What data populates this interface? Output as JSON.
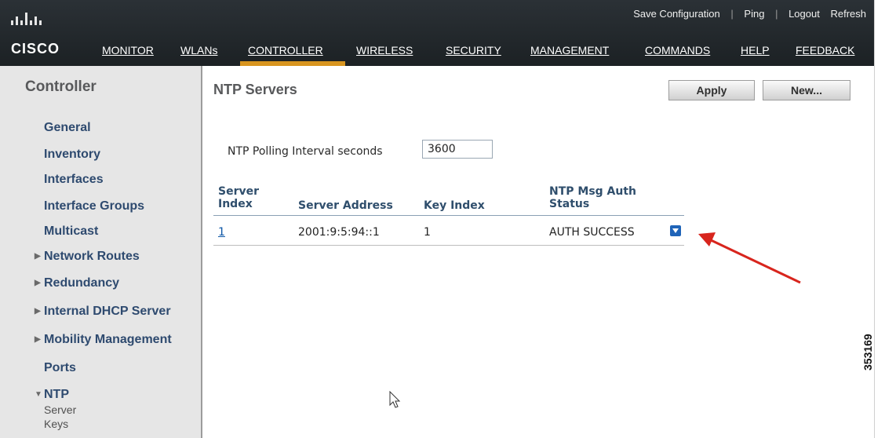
{
  "header": {
    "logo_text": "CISCO",
    "top_links": {
      "save_configuration": "Save Configuration",
      "ping": "Ping",
      "logout": "Logout",
      "refresh": "Refresh",
      "separator": "|"
    },
    "nav": [
      "MONITOR",
      "WLANs",
      "CONTROLLER",
      "WIRELESS",
      "SECURITY",
      "MANAGEMENT",
      "COMMANDS",
      "HELP",
      "FEEDBACK"
    ],
    "active_tab": "CONTROLLER",
    "active_color": "#d8951f"
  },
  "sidebar": {
    "title": "Controller",
    "items": [
      {
        "label": "General",
        "expandable": false
      },
      {
        "label": "Inventory",
        "expandable": false
      },
      {
        "label": "Interfaces",
        "expandable": false
      },
      {
        "label": "Interface Groups",
        "expandable": false
      },
      {
        "label": "Multicast",
        "expandable": false
      },
      {
        "label": "Network Routes",
        "expandable": true
      },
      {
        "label": "Redundancy",
        "expandable": true
      },
      {
        "label": "Internal DHCP Server",
        "expandable": true
      },
      {
        "label": "Mobility Management",
        "expandable": true
      },
      {
        "label": "Ports",
        "expandable": false
      },
      {
        "label": "NTP",
        "expandable": true,
        "expanded": true,
        "children": [
          "Server",
          "Keys"
        ]
      }
    ]
  },
  "main": {
    "page_title": "NTP Servers",
    "buttons": {
      "apply": "Apply",
      "new": "New..."
    },
    "polling_label": "NTP Polling Interval seconds",
    "polling_value": "3600",
    "table": {
      "headers": {
        "server_index_line1": "Server",
        "server_index_line2": "Index",
        "server_address": "Server Address",
        "key_index": "Key Index",
        "auth_status_line1": "NTP Msg Auth",
        "auth_status_line2": "Status"
      },
      "rows": [
        {
          "server_index": "1",
          "server_address": "2001:9:5:94::1",
          "key_index": "1",
          "auth_status": "AUTH SUCCESS"
        }
      ]
    }
  },
  "figure_number": "353169"
}
